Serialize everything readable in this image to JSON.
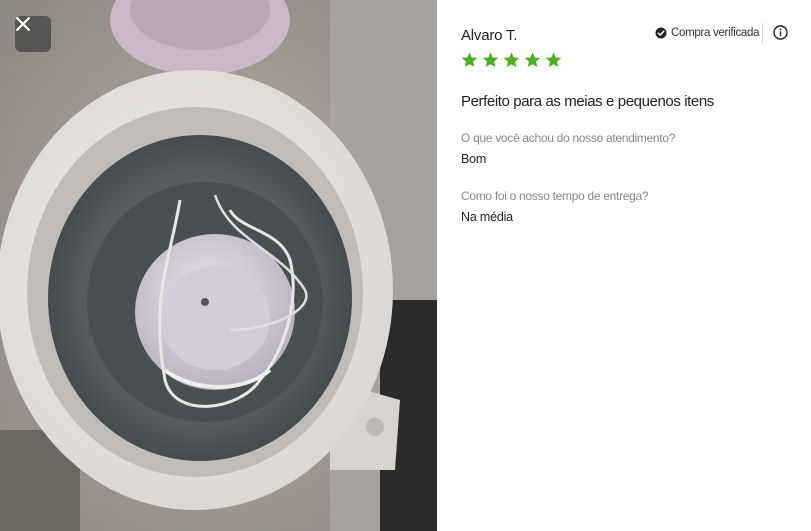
{
  "review": {
    "reviewer_name": "Alvaro T.",
    "verified_label": "Compra verificada",
    "rating": 5,
    "rating_max": 5,
    "star_color": "#4caf20",
    "headline": "Perfeito para as meias e pequenos itens",
    "questions": [
      {
        "question": "O que você achou do nosso atendimento?",
        "answer": "Bom"
      },
      {
        "question": "Como foi o nosso tempo de entrega?",
        "answer": "Na média"
      }
    ]
  },
  "icons": {
    "close": "close-icon",
    "verified": "check-circle-icon",
    "info": "info-icon",
    "star": "star-icon"
  }
}
